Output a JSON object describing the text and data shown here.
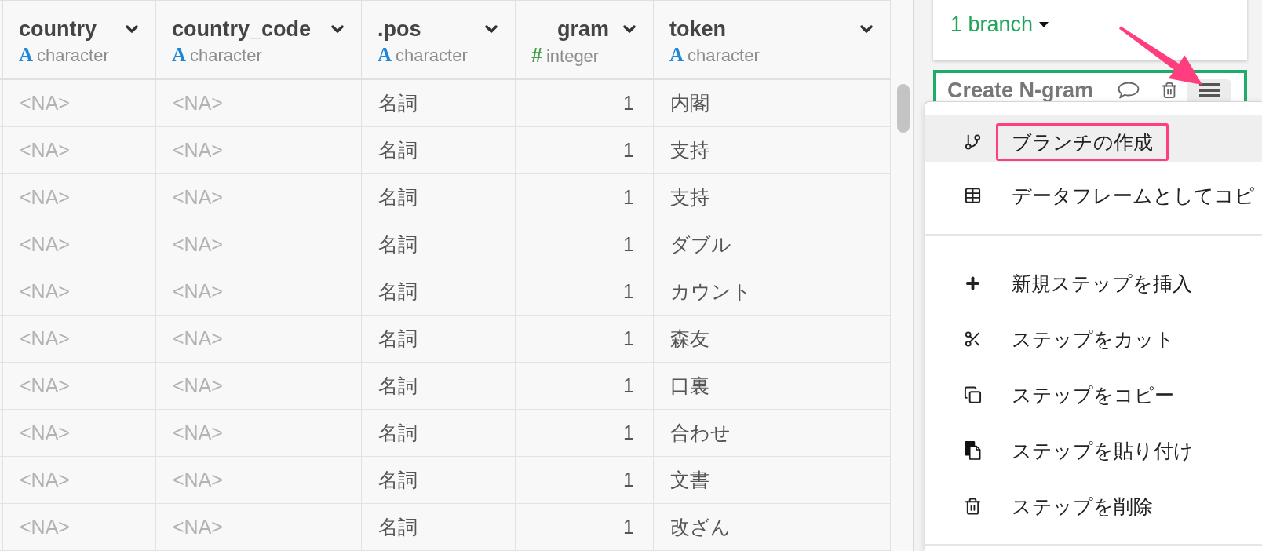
{
  "table": {
    "columns": [
      {
        "name": "country",
        "kind": "character",
        "type_symbol": "A",
        "type_label": "character"
      },
      {
        "name": "country_code",
        "kind": "character",
        "type_symbol": "A",
        "type_label": "character"
      },
      {
        "name": ".pos",
        "kind": "character",
        "type_symbol": "A",
        "type_label": "character"
      },
      {
        "name": "gram",
        "kind": "integer",
        "type_symbol": "#",
        "type_label": "integer"
      },
      {
        "name": "token",
        "kind": "character",
        "type_symbol": "A",
        "type_label": "character"
      }
    ],
    "rows": [
      {
        "cells": [
          {
            "text": "<NA>",
            "na": true
          },
          {
            "text": "<NA>",
            "na": true
          },
          {
            "text": "名詞",
            "na": false
          },
          {
            "text": "1",
            "na": false
          },
          {
            "text": "内閣",
            "na": false
          }
        ]
      },
      {
        "cells": [
          {
            "text": "<NA>",
            "na": true
          },
          {
            "text": "<NA>",
            "na": true
          },
          {
            "text": "名詞",
            "na": false
          },
          {
            "text": "1",
            "na": false
          },
          {
            "text": "支持",
            "na": false
          }
        ]
      },
      {
        "cells": [
          {
            "text": "<NA>",
            "na": true
          },
          {
            "text": "<NA>",
            "na": true
          },
          {
            "text": "名詞",
            "na": false
          },
          {
            "text": "1",
            "na": false
          },
          {
            "text": "支持",
            "na": false
          }
        ]
      },
      {
        "cells": [
          {
            "text": "<NA>",
            "na": true
          },
          {
            "text": "<NA>",
            "na": true
          },
          {
            "text": "名詞",
            "na": false
          },
          {
            "text": "1",
            "na": false
          },
          {
            "text": "ダブル",
            "na": false
          }
        ]
      },
      {
        "cells": [
          {
            "text": "<NA>",
            "na": true
          },
          {
            "text": "<NA>",
            "na": true
          },
          {
            "text": "名詞",
            "na": false
          },
          {
            "text": "1",
            "na": false
          },
          {
            "text": "カウント",
            "na": false
          }
        ]
      },
      {
        "cells": [
          {
            "text": "<NA>",
            "na": true
          },
          {
            "text": "<NA>",
            "na": true
          },
          {
            "text": "名詞",
            "na": false
          },
          {
            "text": "1",
            "na": false
          },
          {
            "text": "森友",
            "na": false
          }
        ]
      },
      {
        "cells": [
          {
            "text": "<NA>",
            "na": true
          },
          {
            "text": "<NA>",
            "na": true
          },
          {
            "text": "名詞",
            "na": false
          },
          {
            "text": "1",
            "na": false
          },
          {
            "text": "口裏",
            "na": false
          }
        ]
      },
      {
        "cells": [
          {
            "text": "<NA>",
            "na": true
          },
          {
            "text": "<NA>",
            "na": true
          },
          {
            "text": "名詞",
            "na": false
          },
          {
            "text": "1",
            "na": false
          },
          {
            "text": "合わせ",
            "na": false
          }
        ]
      },
      {
        "cells": [
          {
            "text": "<NA>",
            "na": true
          },
          {
            "text": "<NA>",
            "na": true
          },
          {
            "text": "名詞",
            "na": false
          },
          {
            "text": "1",
            "na": false
          },
          {
            "text": "文書",
            "na": false
          }
        ]
      },
      {
        "cells": [
          {
            "text": "<NA>",
            "na": true
          },
          {
            "text": "<NA>",
            "na": true
          },
          {
            "text": "名詞",
            "na": false
          },
          {
            "text": "1",
            "na": false
          },
          {
            "text": "改ざん",
            "na": false
          }
        ]
      }
    ]
  },
  "branches": {
    "label": "1 branch"
  },
  "step": {
    "title": "Create N-gram"
  },
  "menu": {
    "sections": [
      {
        "items": [
          {
            "label": "ブランチの作成",
            "selected": true,
            "highlighted": true
          },
          {
            "label": "データフレームとしてコピ",
            "selected": false,
            "highlighted": false
          }
        ]
      },
      {
        "items": [
          {
            "label": "新規ステップを挿入",
            "selected": false,
            "highlighted": false
          },
          {
            "label": "ステップをカット",
            "selected": false,
            "highlighted": false
          },
          {
            "label": "ステップをコピー",
            "selected": false,
            "highlighted": false
          },
          {
            "label": "ステップを貼り付け",
            "selected": false,
            "highlighted": false
          },
          {
            "label": "ステップを削除",
            "selected": false,
            "highlighted": false
          }
        ]
      }
    ]
  }
}
